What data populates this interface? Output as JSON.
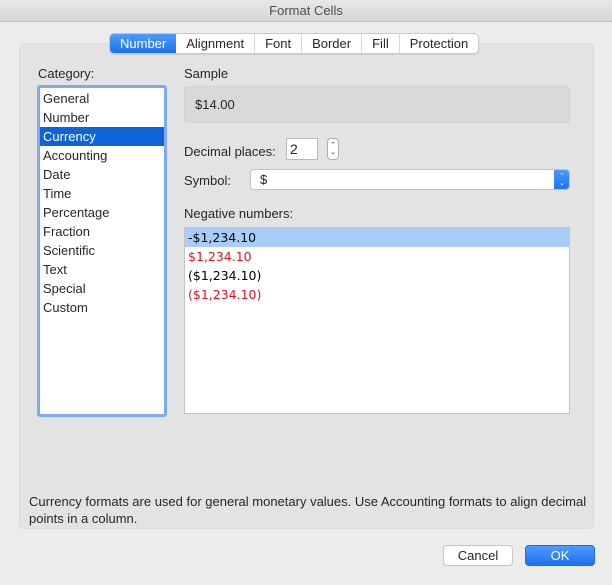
{
  "window": {
    "title": "Format Cells"
  },
  "tabs": [
    {
      "label": "Number",
      "active": true
    },
    {
      "label": "Alignment",
      "active": false
    },
    {
      "label": "Font",
      "active": false
    },
    {
      "label": "Border",
      "active": false
    },
    {
      "label": "Fill",
      "active": false
    },
    {
      "label": "Protection",
      "active": false
    }
  ],
  "category": {
    "label": "Category:",
    "items": [
      "General",
      "Number",
      "Currency",
      "Accounting",
      "Date",
      "Time",
      "Percentage",
      "Fraction",
      "Scientific",
      "Text",
      "Special",
      "Custom"
    ],
    "selected": "Currency"
  },
  "sample": {
    "label": "Sample",
    "value": "$14.00"
  },
  "decimal_places": {
    "label": "Decimal places:",
    "value": "2",
    "stepper_up": "⌃",
    "stepper_down": "⌄"
  },
  "symbol": {
    "label": "Symbol:",
    "value": "$",
    "arrow_up": "⌃",
    "arrow_down": "⌄"
  },
  "negative_numbers": {
    "label": "Negative numbers:",
    "items": [
      {
        "text": "-$1,234.10",
        "color": "#000000",
        "selected": true
      },
      {
        "text": "$1,234.10",
        "color": "#e8121f",
        "selected": false
      },
      {
        "text": "($1,234.10)",
        "color": "#000000",
        "selected": false
      },
      {
        "text": "($1,234.10)",
        "color": "#e8121f",
        "selected": false
      }
    ]
  },
  "description": "Currency formats are used for general monetary values.  Use Accounting formats to align decimal points in a column.",
  "buttons": {
    "cancel": "Cancel",
    "ok": "OK"
  },
  "colors": {
    "accent": "#1b72f0",
    "selection": "#0f63d8",
    "negative_red": "#e8121f",
    "neg_selection": "#a8cdf8"
  }
}
